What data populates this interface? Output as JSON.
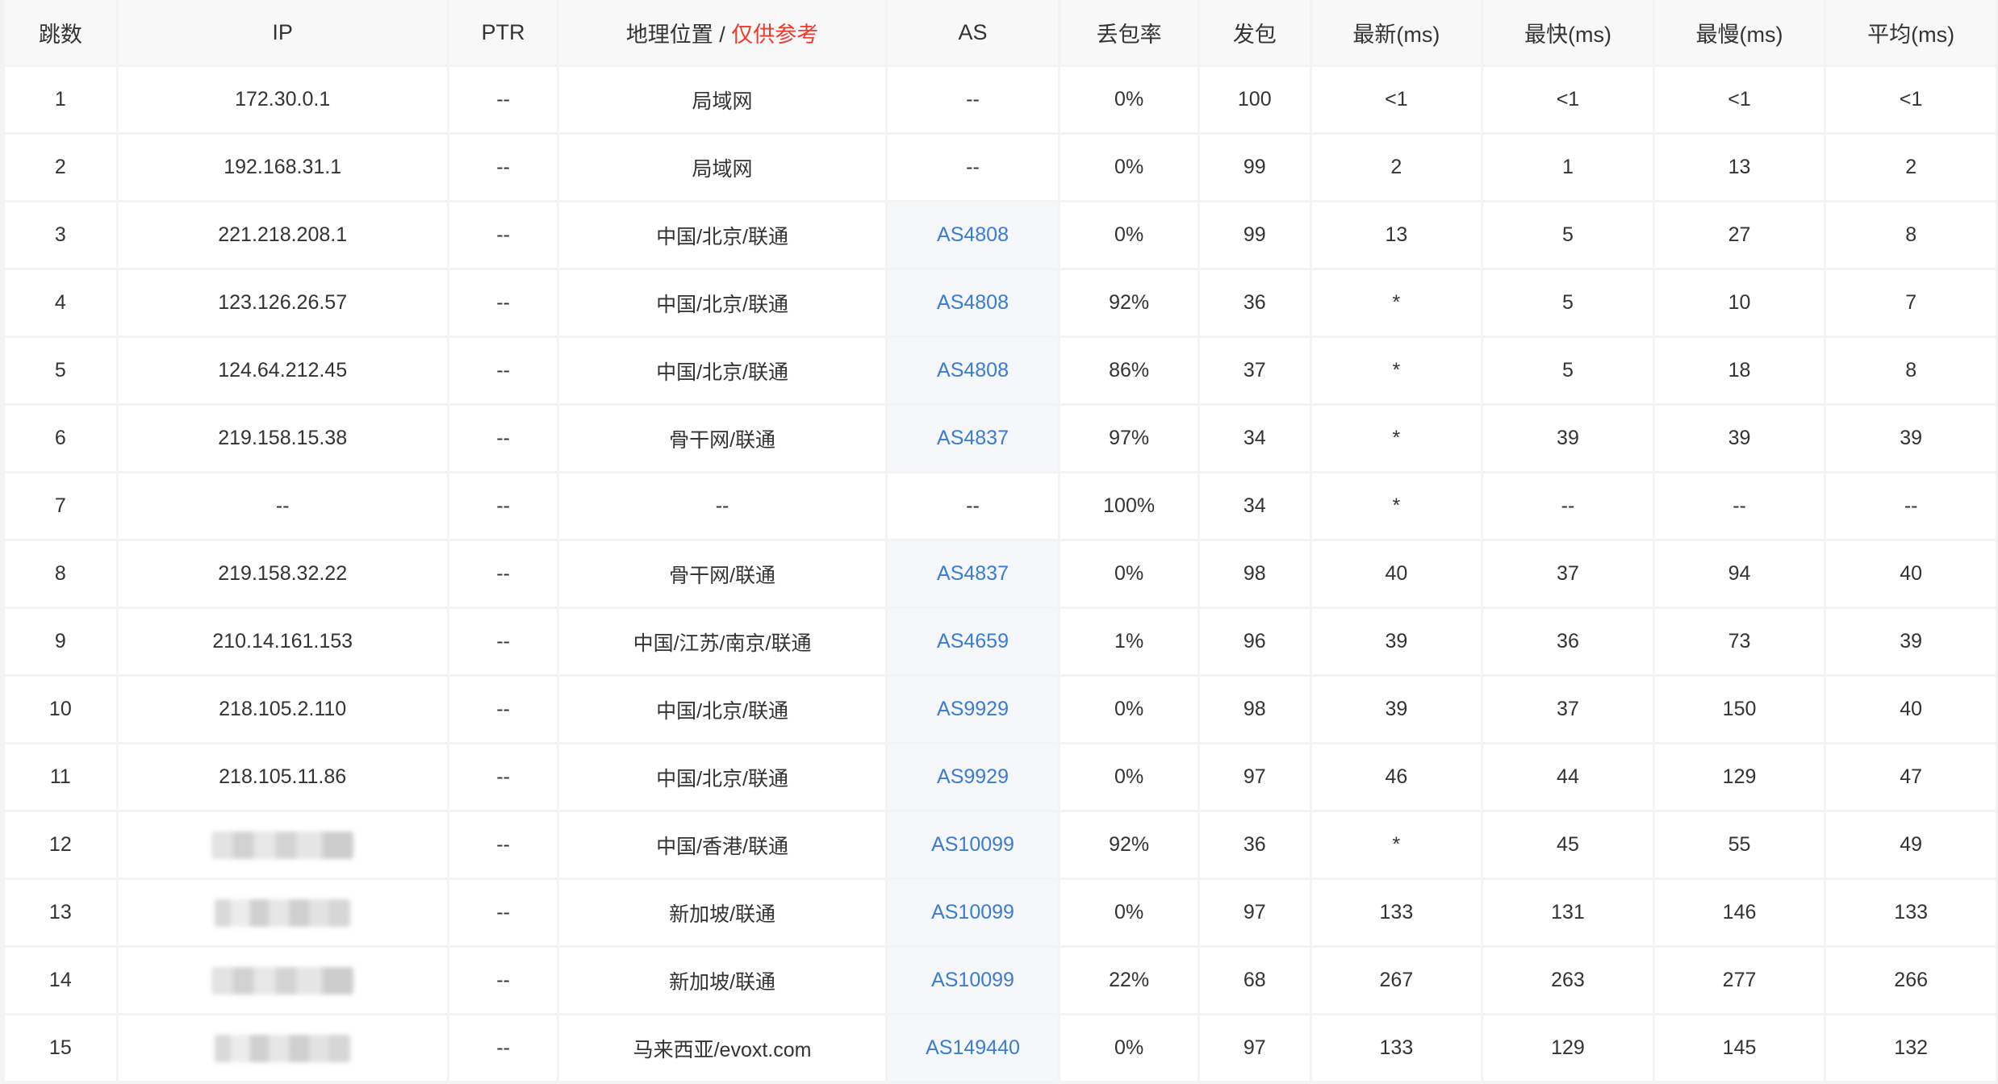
{
  "headers": {
    "hop": "跳数",
    "ip": "IP",
    "ptr": "PTR",
    "geo_prefix": "地理位置",
    "geo_sep": " / ",
    "geo_note": "仅供参考",
    "as": "AS",
    "loss": "丢包率",
    "sent": "发包",
    "last": "最新(ms)",
    "best": "最快(ms)",
    "worst": "最慢(ms)",
    "avg": "平均(ms)"
  },
  "colors": {
    "link": "#3a7bd5",
    "note_red": "#f0392f",
    "header_bg": "#f8f8f8",
    "grid": "#f3f3f3"
  },
  "rows": [
    {
      "hop": "1",
      "ip": "172.30.0.1",
      "ptr": "--",
      "geo": "局域网",
      "as": "--",
      "loss": "0%",
      "sent": "100",
      "last": "<1",
      "best": "<1",
      "worst": "<1",
      "avg": "<1"
    },
    {
      "hop": "2",
      "ip": "192.168.31.1",
      "ptr": "--",
      "geo": "局域网",
      "as": "--",
      "loss": "0%",
      "sent": "99",
      "last": "2",
      "best": "1",
      "worst": "13",
      "avg": "2"
    },
    {
      "hop": "3",
      "ip": "221.218.208.1",
      "ptr": "--",
      "geo": "中国/北京/联通",
      "as": "AS4808",
      "loss": "0%",
      "sent": "99",
      "last": "13",
      "best": "5",
      "worst": "27",
      "avg": "8"
    },
    {
      "hop": "4",
      "ip": "123.126.26.57",
      "ptr": "--",
      "geo": "中国/北京/联通",
      "as": "AS4808",
      "loss": "92%",
      "sent": "36",
      "last": "*",
      "best": "5",
      "worst": "10",
      "avg": "7"
    },
    {
      "hop": "5",
      "ip": "124.64.212.45",
      "ptr": "--",
      "geo": "中国/北京/联通",
      "as": "AS4808",
      "loss": "86%",
      "sent": "37",
      "last": "*",
      "best": "5",
      "worst": "18",
      "avg": "8"
    },
    {
      "hop": "6",
      "ip": "219.158.15.38",
      "ptr": "--",
      "geo": "骨干网/联通",
      "as": "AS4837",
      "loss": "97%",
      "sent": "34",
      "last": "*",
      "best": "39",
      "worst": "39",
      "avg": "39"
    },
    {
      "hop": "7",
      "ip": "--",
      "ptr": "--",
      "geo": "--",
      "as": "--",
      "loss": "100%",
      "sent": "34",
      "last": "*",
      "best": "--",
      "worst": "--",
      "avg": "--"
    },
    {
      "hop": "8",
      "ip": "219.158.32.22",
      "ptr": "--",
      "geo": "骨干网/联通",
      "as": "AS4837",
      "loss": "0%",
      "sent": "98",
      "last": "40",
      "best": "37",
      "worst": "94",
      "avg": "40"
    },
    {
      "hop": "9",
      "ip": "210.14.161.153",
      "ptr": "--",
      "geo": "中国/江苏/南京/联通",
      "as": "AS4659",
      "loss": "1%",
      "sent": "96",
      "last": "39",
      "best": "36",
      "worst": "73",
      "avg": "39"
    },
    {
      "hop": "10",
      "ip": "218.105.2.110",
      "ptr": "--",
      "geo": "中国/北京/联通",
      "as": "AS9929",
      "loss": "0%",
      "sent": "98",
      "last": "39",
      "best": "37",
      "worst": "150",
      "avg": "40"
    },
    {
      "hop": "11",
      "ip": "218.105.11.86",
      "ptr": "--",
      "geo": "中国/北京/联通",
      "as": "AS9929",
      "loss": "0%",
      "sent": "97",
      "last": "46",
      "best": "44",
      "worst": "129",
      "avg": "47"
    },
    {
      "hop": "12",
      "ip": "",
      "ptr": "--",
      "geo": "中国/香港/联通",
      "as": "AS10099",
      "loss": "92%",
      "sent": "36",
      "last": "*",
      "best": "45",
      "worst": "55",
      "avg": "49"
    },
    {
      "hop": "13",
      "ip": "",
      "ptr": "--",
      "geo": "新加坡/联通",
      "as": "AS10099",
      "loss": "0%",
      "sent": "97",
      "last": "133",
      "best": "131",
      "worst": "146",
      "avg": "133"
    },
    {
      "hop": "14",
      "ip": "",
      "ptr": "--",
      "geo": "新加坡/联通",
      "as": "AS10099",
      "loss": "22%",
      "sent": "68",
      "last": "267",
      "best": "263",
      "worst": "277",
      "avg": "266"
    },
    {
      "hop": "15",
      "ip": "",
      "ptr": "--",
      "geo": "马来西亚/evoxt.com",
      "as": "AS149440",
      "loss": "0%",
      "sent": "97",
      "last": "133",
      "best": "129",
      "worst": "145",
      "avg": "132"
    }
  ]
}
